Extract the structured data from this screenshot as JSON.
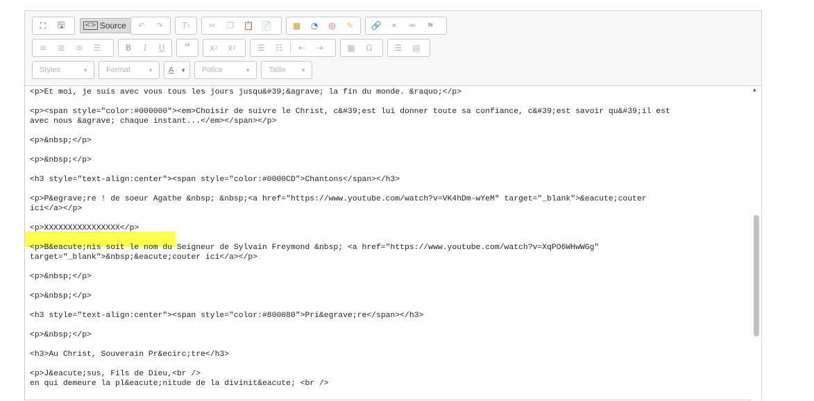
{
  "toolbar": {
    "source_label": "Source",
    "combos": {
      "styles": "Styles",
      "format": "Format",
      "font": "Police",
      "size": "Taille",
      "color": "A"
    }
  },
  "source_lines": [
    "<p>Et moi, je suis avec vous tous les jours jusqu&#39;&agrave; la fin du monde. &raquo;</p>",
    "<p><span style=\"color:#000000\"><em>Choisir de suivre le Christ, c&#39;est lui donner toute sa confiance, c&#39;est savoir qu&#39;il est",
    "avec nous &agrave; chaque instant...</em></span></p>",
    "<p>&nbsp;</p>",
    "<p>&nbsp;</p>",
    "<h3 style=\"text-align:center\"><span style=\"color:#0000CD\">Chantons</span></h3>",
    "<p>P&egrave;re ! de soeur Agathe &nbsp; &nbsp;<a href=\"https://www.youtube.com/watch?v=VK4hDm-wYeM\" target=\"_blank\">&eacute;couter",
    "ici</a></p>",
    "<p>XXXXXXXXXXXXXXXX</p>",
    "<p>B&eacute;nis soit le nom du Seigneur de Sylvain Freymond &nbsp; <a href=\"https://www.youtube.com/watch?v=XqPO6WHwWGg\"",
    "target=\"_blank\">&nbsp;&eacute;couter ici</a></p>",
    "<p>&nbsp;</p>",
    "<p>&nbsp;</p>",
    "<h3 style=\"text-align:center\"><span style=\"color:#800080\">Pri&egrave;re</span></h3>",
    "<p>&nbsp;</p>",
    "<h3>Au Christ, Souverain Pr&ecirc;tre</h3>",
    "<p>J&eacute;sus, Fils de Dieu,<br />",
    "en qui demeure la pl&eacute;nitude de la divinit&eacute; <br />"
  ],
  "colors": {
    "highlight": "#ffff3a",
    "editor_border": "#d1d1d1"
  }
}
